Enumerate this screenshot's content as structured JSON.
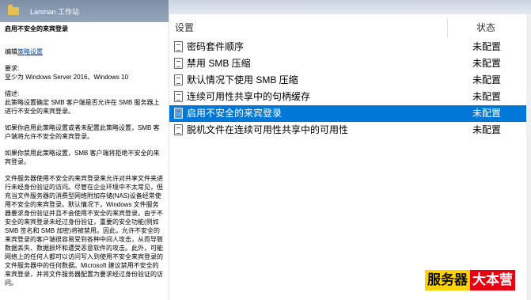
{
  "left_header": {
    "title": "Lanman 工作站"
  },
  "description": {
    "policy_title": "启用不安全的来宾登录",
    "edit_prefix": "编辑",
    "edit_link": "策略设置",
    "requirements_label": "要求:",
    "requirements_value": "至少为 Windows Server 2016、Windows 10",
    "desc_label": "描述:",
    "paragraphs": [
      "此策略设置确定 SMB 客户端是否允许在 SMB 服务器上进行不安全的来宾登录。",
      "如果你启用此策略设置或者未配置此策略设置，SMB 客户端将允许不安全的来宾登录。",
      "如果你禁用此策略设置，SMB 客户端将拒绝不安全的来宾登录。",
      "文件服务器使用不安全的来宾登录来允许对共享文件夹进行未经身份验证的访问。尽管在企业环境中不太常见，但充当文件服务器的消费型网络附加存储(NAS)设备经常使用不安全的来宾登录。默认情况下，Windows 文件服务器要求身份验证并且不会使用不安全的来宾登录。由于不安全的来宾登录未经过身份验证，重要的安全功能(例如 SMB 签名和 SMB 加密)将被禁用。因此，允许不安全的来宾登录的客户端很容易受到各种中间人攻击，从而导致数据丢失、数据损坏和遭受恶意软件的攻击。此外，可能网络上的任何人都可以访问写入到使用不安全来宾登录的文件服务器中的任何数据。Microsoft 建议禁用不安全的来宾登录，并将文件服务器配置为要求经过身份验证的访问。"
    ]
  },
  "list": {
    "col_setting": "设置",
    "col_status": "状态",
    "rows": [
      {
        "name": "密码套件顺序",
        "state": "未配置"
      },
      {
        "name": "禁用 SMB 压缩",
        "state": "未配置"
      },
      {
        "name": "默认情况下使用 SMB 压缩",
        "state": "未配置"
      },
      {
        "name": "连续可用性共享中的句柄缓存",
        "state": "未配置"
      },
      {
        "name": "启用不安全的来宾登录",
        "state": "未配置"
      },
      {
        "name": "脱机文件在连续可用性共享中的可用性",
        "state": "未配置"
      }
    ],
    "selected_index": 4
  },
  "watermark": {
    "part1": "服务器",
    "part2": "大本营"
  },
  "colors": {
    "selection": "#0078d7",
    "link": "#0645ad"
  }
}
